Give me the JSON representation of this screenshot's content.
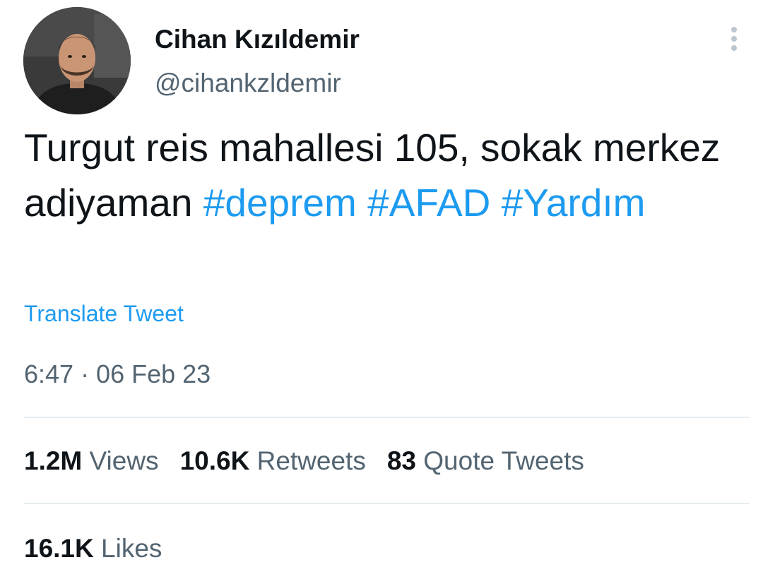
{
  "author": {
    "display_name": "Cihan Kızıldemir",
    "handle": "@cihankzldemir"
  },
  "tweet": {
    "text_part1": "Turgut reis mahallesi 105, sokak merkez adiyaman ",
    "hashtags": [
      "#deprem",
      "#AFAD",
      "#Yardım"
    ],
    "translate_label": "Translate Tweet",
    "timestamp": "6:47 · 06 Feb 23"
  },
  "stats": {
    "views_count": "1.2M",
    "views_label": "Views",
    "retweets_count": "10.6K",
    "retweets_label": "Retweets",
    "quotes_count": "83",
    "quotes_label": "Quote Tweets",
    "likes_count": "16.1K",
    "likes_label": "Likes"
  },
  "icons": {
    "more": "more-vertical-icon",
    "avatar": "profile-photo"
  },
  "colors": {
    "link": "#1d9bf0",
    "secondary_text": "#536471",
    "primary_text": "#0f1419",
    "divider": "#e6ecf0"
  }
}
